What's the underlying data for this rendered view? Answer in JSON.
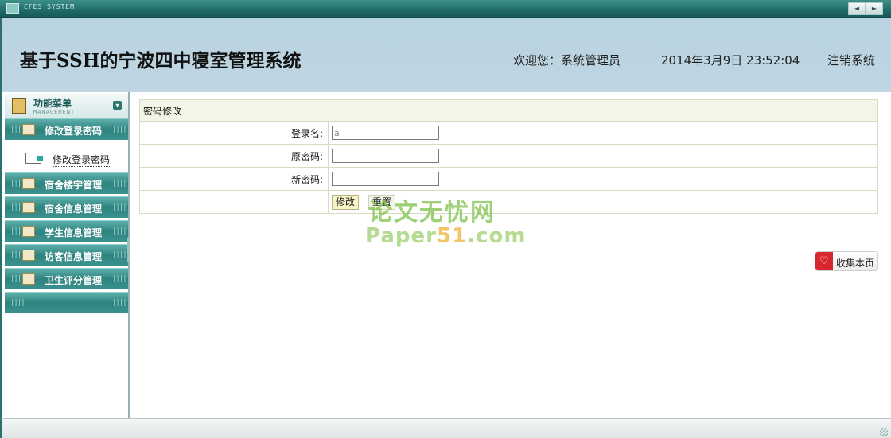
{
  "window": {
    "title": "CFES SYSTEM",
    "prev_glyph": "◄",
    "next_glyph": "►"
  },
  "header": {
    "system_title": "基于SSH的宁波四中寝室管理系统",
    "welcome": "欢迎您：系统管理员",
    "datetime": "2014年3月9日  23:52:04",
    "logout": "注销系统"
  },
  "sidebar": {
    "title": "功能菜单",
    "subtitle": "MANAGEMENT",
    "collapse_glyph": "▾",
    "grip": "||||",
    "items": [
      {
        "label": "修改登录密码",
        "icon": "user-card-icon"
      },
      {
        "label": "宿舍楼宇管理",
        "icon": "user-card-icon"
      },
      {
        "label": "宿舍信息管理",
        "icon": "user-card-icon"
      },
      {
        "label": "学生信息管理",
        "icon": "user-card-icon"
      },
      {
        "label": "访客信息管理",
        "icon": "user-card-icon"
      },
      {
        "label": "卫生评分管理",
        "icon": "user-card-icon"
      }
    ],
    "sub_item": {
      "label": "修改登录密码"
    }
  },
  "form": {
    "title": "密码修改",
    "username_label": "登录名:",
    "username_value": "a",
    "old_password_label": "原密码:",
    "new_password_label": "新密码:",
    "modify_button": "修改",
    "reset_button": "重置"
  },
  "watermark": {
    "cn": "论文无忧网",
    "en_prefix": "Paper",
    "en_num": "51",
    "en_suffix": ".com"
  },
  "bookmark": {
    "label": "收集本页",
    "icon_glyph": "♡"
  },
  "colors": {
    "accent": "#2e837f",
    "header_bg": "#bfd6e2",
    "table_border": "#d6dbc3"
  }
}
